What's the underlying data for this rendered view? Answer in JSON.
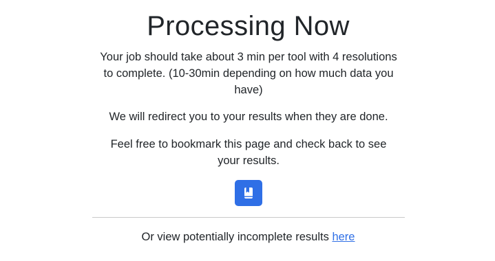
{
  "heading": "Processing Now",
  "paragraphs": {
    "job_estimate": "Your job should take about 3 min per tool with 4 resolutions to complete. (10-30min depending on how much data you have)",
    "redirect_note": "We will redirect you to your results when they are done.",
    "bookmark_note": "Feel free to bookmark this page and check back to see your results."
  },
  "bookmark_button": {
    "icon": "bookmark-book-icon",
    "color": "#2f6fe6"
  },
  "footer": {
    "prefix": "Or view potentially incomplete results ",
    "link_text": "here"
  }
}
